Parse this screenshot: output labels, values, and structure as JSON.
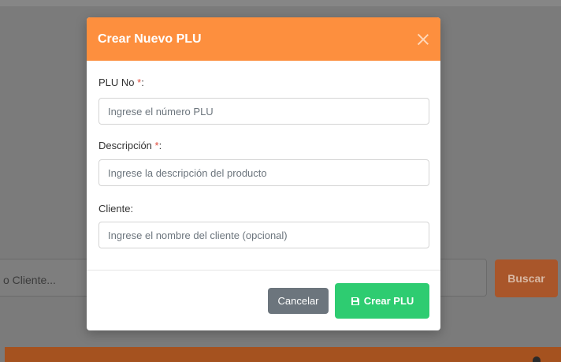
{
  "background": {
    "search_text": "o Cliente...",
    "search_button": "Buscar"
  },
  "modal": {
    "title": "Crear Nuevo PLU",
    "fields": [
      {
        "label": "PLU No ",
        "required_mark": "*",
        "suffix": ":",
        "placeholder": "Ingrese el número PLU"
      },
      {
        "label": "Descripción ",
        "required_mark": "*",
        "suffix": ":",
        "placeholder": "Ingrese la descripción del producto"
      },
      {
        "label": "Cliente:",
        "placeholder": "Ingrese el nombre del cliente (opcional)"
      }
    ],
    "cancel_label": "Cancelar",
    "create_label": "Crear PLU",
    "colors": {
      "header": "#fd8f3e",
      "create_button": "#2ecc71",
      "cancel_button": "#6c757d",
      "required": "#e04b3c"
    }
  }
}
